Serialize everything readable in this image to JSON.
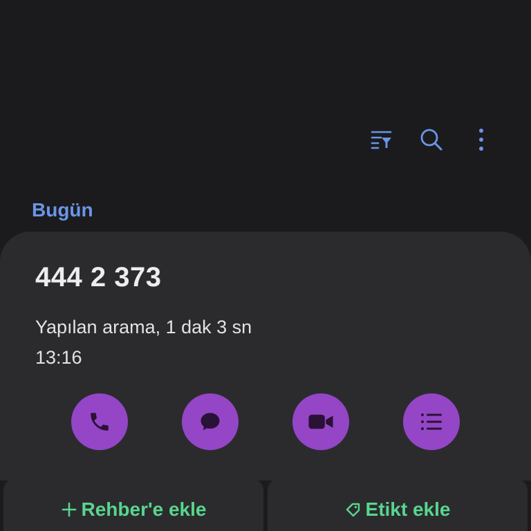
{
  "toolbar": {
    "icons": [
      "filter-icon",
      "search-icon",
      "more-options-icon"
    ],
    "accent_color": "#6b95e8"
  },
  "section": {
    "label": "Bugün"
  },
  "call": {
    "number": "444 2 373",
    "info": "Yapılan arama, 1 dak 3 sn",
    "time": "13:16"
  },
  "actions": {
    "icons": [
      "phone-icon",
      "message-icon",
      "video-call-icon",
      "details-list-icon"
    ],
    "button_color": "#9446c6"
  },
  "bottom": {
    "add_contact_label": "Rehber'e ekle",
    "add_tag_label": "Etikt ekle",
    "label_color": "#58d68d"
  }
}
